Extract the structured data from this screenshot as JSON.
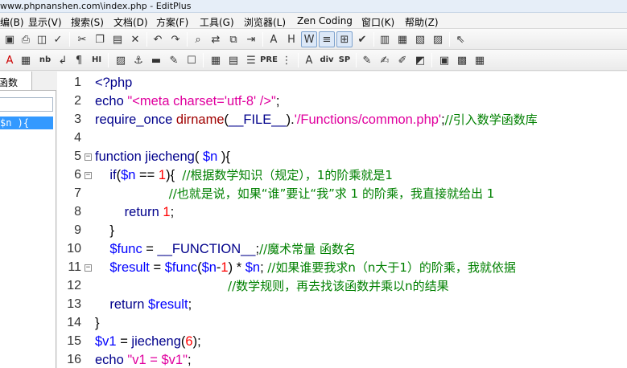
{
  "window": {
    "title": "www.phpnanshen.com\\index.php - EditPlus"
  },
  "menu": [
    {
      "label": "编(B)"
    },
    {
      "label": "显示(V)"
    },
    {
      "label": "搜索(S)"
    },
    {
      "label": "文档(D)"
    },
    {
      "label": "方案(F)"
    },
    {
      "label": "工具(G)"
    },
    {
      "label": "浏览器(L)"
    },
    {
      "label": "Zen Coding"
    },
    {
      "label": "窗口(K)"
    },
    {
      "label": "帮助(Z)"
    }
  ],
  "toolbar2_labels": {
    "nb": "nb",
    "hi": "HI",
    "pre": "PRE",
    "div": "div",
    "sp": "SP"
  },
  "sidebar": {
    "tab_label": "函数",
    "function_item": "$n ){"
  },
  "editor": {
    "lines": [
      {
        "n": "1",
        "fold": "",
        "parts": [
          {
            "t": "<?php",
            "c": "k"
          }
        ]
      },
      {
        "n": "2",
        "fold": "",
        "parts": [
          {
            "t": "echo ",
            "c": "k"
          },
          {
            "t": "\"<meta charset='utf-8' />\"",
            "c": "s"
          },
          {
            "t": ";",
            "c": "p"
          }
        ]
      },
      {
        "n": "3",
        "fold": "",
        "parts": [
          {
            "t": "require_once ",
            "c": "k"
          },
          {
            "t": "dirname",
            "c": "fn"
          },
          {
            "t": "(",
            "c": "p"
          },
          {
            "t": "__FILE__",
            "c": "k"
          },
          {
            "t": ").",
            "c": "p"
          },
          {
            "t": "'/Functions/common.php'",
            "c": "s"
          },
          {
            "t": ";",
            "c": "p"
          },
          {
            "t": "//引入数学函数库",
            "c": "c"
          }
        ]
      },
      {
        "n": "4",
        "fold": "",
        "parts": []
      },
      {
        "n": "5",
        "fold": "⊟",
        "parts": [
          {
            "t": "function ",
            "c": "k"
          },
          {
            "t": "jiecheng",
            "c": "k"
          },
          {
            "t": "( ",
            "c": "p"
          },
          {
            "t": "$n",
            "c": "v"
          },
          {
            "t": " ){",
            "c": "p"
          }
        ]
      },
      {
        "n": "6",
        "fold": "⊟",
        "parts": [
          {
            "t": "    if",
            "c": "k"
          },
          {
            "t": "(",
            "c": "p"
          },
          {
            "t": "$n",
            "c": "v"
          },
          {
            "t": " == ",
            "c": "p"
          },
          {
            "t": "1",
            "c": "n"
          },
          {
            "t": "){  ",
            "c": "p"
          },
          {
            "t": "//根据数学知识（规定），1的阶乘就是1",
            "c": "c"
          }
        ]
      },
      {
        "n": "7",
        "fold": "",
        "parts": [
          {
            "t": "                    ",
            "c": "p"
          },
          {
            "t": "//也就是说，如果“谁”要让“我”求 1 的阶乘，我直接就给出 1",
            "c": "c"
          }
        ]
      },
      {
        "n": "8",
        "fold": "",
        "parts": [
          {
            "t": "        return ",
            "c": "k"
          },
          {
            "t": "1",
            "c": "n"
          },
          {
            "t": ";",
            "c": "p"
          }
        ]
      },
      {
        "n": "9",
        "fold": "",
        "parts": [
          {
            "t": "    }",
            "c": "p"
          }
        ]
      },
      {
        "n": "10",
        "fold": "",
        "parts": [
          {
            "t": "    $func",
            "c": "v"
          },
          {
            "t": " = ",
            "c": "p"
          },
          {
            "t": "__FUNCTION__",
            "c": "k"
          },
          {
            "t": ";",
            "c": "p"
          },
          {
            "t": "//魔术常量 函数名",
            "c": "c"
          }
        ]
      },
      {
        "n": "11",
        "fold": "⊟",
        "parts": [
          {
            "t": "    $result",
            "c": "v"
          },
          {
            "t": " = ",
            "c": "p"
          },
          {
            "t": "$func",
            "c": "v"
          },
          {
            "t": "(",
            "c": "p"
          },
          {
            "t": "$n",
            "c": "v"
          },
          {
            "t": "-",
            "c": "p"
          },
          {
            "t": "1",
            "c": "n"
          },
          {
            "t": ") * ",
            "c": "p"
          },
          {
            "t": "$n",
            "c": "v"
          },
          {
            "t": "; ",
            "c": "p"
          },
          {
            "t": "//如果谁要我求n（n大于1）的阶乘，我就依据",
            "c": "c"
          }
        ]
      },
      {
        "n": "12",
        "fold": "",
        "parts": [
          {
            "t": "                                    ",
            "c": "p"
          },
          {
            "t": "//数学规则，再去找该函数并乘以n的结果",
            "c": "c"
          }
        ]
      },
      {
        "n": "13",
        "fold": "",
        "parts": [
          {
            "t": "    return ",
            "c": "k"
          },
          {
            "t": "$result",
            "c": "v"
          },
          {
            "t": ";",
            "c": "p"
          }
        ]
      },
      {
        "n": "14",
        "fold": "",
        "parts": [
          {
            "t": "}",
            "c": "p"
          }
        ]
      },
      {
        "n": "15",
        "fold": "",
        "parts": [
          {
            "t": "$v1",
            "c": "v"
          },
          {
            "t": " = ",
            "c": "p"
          },
          {
            "t": "jiecheng",
            "c": "k"
          },
          {
            "t": "(",
            "c": "p"
          },
          {
            "t": "6",
            "c": "n"
          },
          {
            "t": ");",
            "c": "p"
          }
        ]
      },
      {
        "n": "16",
        "fold": "",
        "parts": [
          {
            "t": "echo ",
            "c": "k"
          },
          {
            "t": "\"v1 = $v1\"",
            "c": "s"
          },
          {
            "t": ";",
            "c": "p"
          }
        ]
      }
    ]
  }
}
